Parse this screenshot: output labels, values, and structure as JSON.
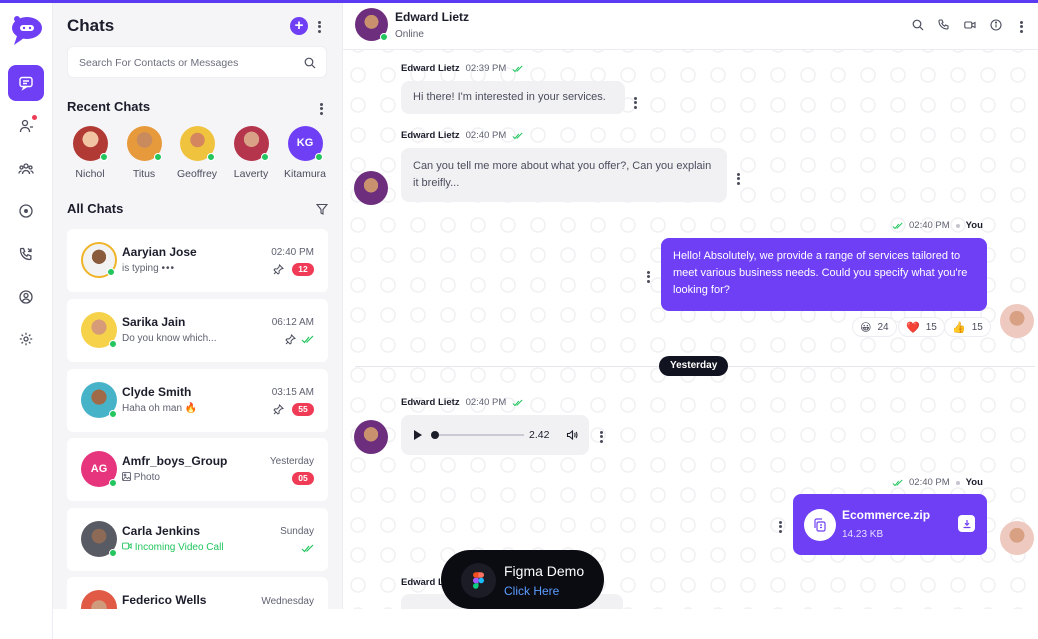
{
  "sidebar": {
    "nav_items": [
      "chats-icon",
      "contacts-icon",
      "groups-icon",
      "status-icon",
      "calls-icon",
      "profile-icon",
      "settings-icon"
    ]
  },
  "list": {
    "title": "Chats",
    "search_placeholder": "Search For Contacts or Messages",
    "recent_title": "Recent Chats",
    "recent": [
      {
        "name": "Nichol"
      },
      {
        "name": "Titus"
      },
      {
        "name": "Geoffrey"
      },
      {
        "name": "Laverty"
      },
      {
        "name": "Kitamura",
        "initials": "KG"
      }
    ],
    "all_title": "All Chats",
    "chats": [
      {
        "name": "Aaryian Jose",
        "preview": "is typing",
        "time": "02:40 PM",
        "badge": "12"
      },
      {
        "name": "Sarika Jain",
        "preview": "Do you know which...",
        "time": "06:12 AM"
      },
      {
        "name": "Clyde Smith",
        "preview": "Haha oh man 🔥",
        "time": "03:15 AM",
        "badge": "55"
      },
      {
        "name": "Amfr_boys_Group",
        "initials": "AG",
        "preview": "Photo",
        "time": "Yesterday",
        "badge": "05"
      },
      {
        "name": "Carla Jenkins",
        "preview": "Incoming Video Call",
        "time": "Sunday"
      },
      {
        "name": "Federico Wells",
        "time": "Wednesday"
      }
    ]
  },
  "chat": {
    "contact_name": "Edward Lietz",
    "status": "Online",
    "messages": [
      {
        "sender": "Edward Lietz",
        "time": "02:39 PM",
        "text": "Hi there! I'm interested in your services."
      },
      {
        "sender": "Edward Lietz",
        "time": "02:40 PM",
        "text": "Can you tell me more about what you offer?, Can you explain it breifly..."
      },
      {
        "sender": "You",
        "time": "02:40 PM",
        "text": "Hello! Absolutely, we provide a range of services tailored to meet various business needs. Could you specify what you're looking for?"
      },
      {
        "sender": "Edward Lietz",
        "time": "02:40 PM",
        "audio_duration": "2.42"
      },
      {
        "sender": "You",
        "time": "02:40 PM",
        "file_name": "Ecommerce.zip",
        "file_size": "14.23 KB"
      },
      {
        "sender": "Edward L"
      }
    ],
    "reactions": [
      {
        "emoji": "😀",
        "count": "24"
      },
      {
        "emoji": "❤️",
        "count": "15"
      },
      {
        "emoji": "👍",
        "count": "15"
      }
    ],
    "date_divider": "Yesterday"
  },
  "figma_badge": {
    "title": "Figma Demo",
    "action": "Click Here"
  },
  "colors": {
    "accent": "#6f3ff5",
    "badge": "#ef3b55",
    "online": "#22c55e"
  }
}
